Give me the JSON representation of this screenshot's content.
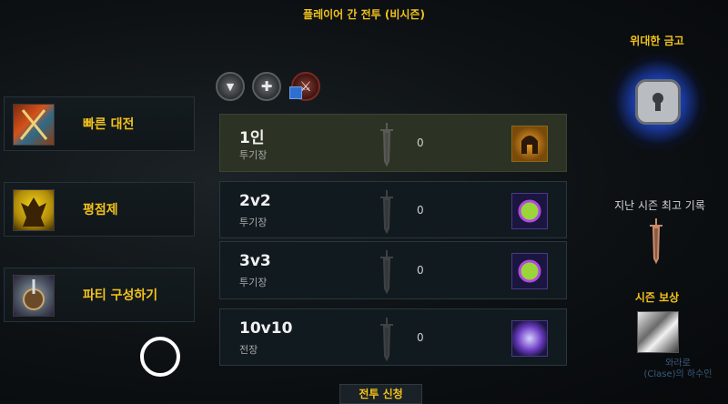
{
  "header": {
    "title": "플레이어 간 전투 (비시즌)"
  },
  "modes": [
    {
      "label": "빠른 대전",
      "icon": "crossed-swords-banner-icon"
    },
    {
      "label": "평점제",
      "icon": "champion-warrior-icon"
    },
    {
      "label": "파티 구성하기",
      "icon": "party-armor-icon"
    }
  ],
  "filters": [
    {
      "icon": "tank-role-icon",
      "glyph": "▼"
    },
    {
      "icon": "healer-role-icon",
      "glyph": "✚"
    },
    {
      "icon": "damage-role-icon",
      "glyph": "⚔"
    }
  ],
  "brackets": [
    {
      "name": "1인",
      "type": "투기장",
      "count": "0",
      "selected": true,
      "rank_icon": "gladiator-helmet-icon"
    },
    {
      "name": "2v2",
      "type": "투기장",
      "count": "0",
      "selected": false,
      "rank_icon": "rank-orb-icon"
    },
    {
      "name": "3v3",
      "type": "투기장",
      "count": "0",
      "selected": false,
      "rank_icon": "rank-orb-icon"
    },
    {
      "name": "10v10",
      "type": "전장",
      "count": "0",
      "selected": false,
      "rank_icon": "battleground-orb-icon"
    }
  ],
  "right_panel": {
    "vault_title": "위대한 금고",
    "last_season_title": "지난 시즌 최고 기록",
    "season_reward_title": "시즌 보상",
    "reward_caption_line1": "와라로",
    "reward_caption_line2": "(Clase)의 하수인"
  },
  "footer": {
    "apply_label": "전투 신청"
  },
  "colors": {
    "gold": "#f2c21b",
    "vault_glow": "#2f6cff",
    "selected_row": "#2c3324"
  }
}
